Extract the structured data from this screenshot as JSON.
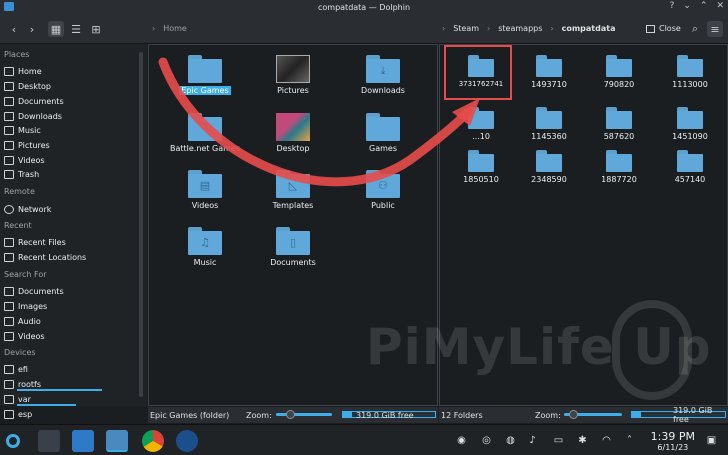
{
  "window": {
    "title": "compatdata — Dolphin"
  },
  "toolbar": {
    "back_icon": "chevron-left",
    "forward_icon": "chevron-right",
    "left_breadcrumb": [
      "Home"
    ],
    "right_breadcrumb": [
      "Steam",
      "steamapps",
      "compatdata"
    ],
    "close_label": "Close"
  },
  "sidebar": {
    "places_header": "Places",
    "places": [
      "Home",
      "Desktop",
      "Documents",
      "Downloads",
      "Music",
      "Pictures",
      "Videos",
      "Trash"
    ],
    "remote_header": "Remote",
    "remote": [
      "Network"
    ],
    "recent_header": "Recent",
    "recent": [
      "Recent Files",
      "Recent Locations"
    ],
    "searchfor_header": "Search For",
    "searchfor": [
      "Documents",
      "Images",
      "Audio",
      "Videos"
    ],
    "devices_header": "Devices",
    "devices": [
      {
        "name": "efi",
        "usage": null
      },
      {
        "name": "rootfs",
        "usage": 0.72
      },
      {
        "name": "var",
        "usage": 0.5
      },
      {
        "name": "esp",
        "usage": null
      }
    ]
  },
  "left_pane": {
    "items": [
      "Epic Games",
      "Pictures",
      "Downloads",
      "Battle.net Games",
      "Desktop",
      "Games",
      "Videos",
      "Templates",
      "Public",
      "Music",
      "Documents"
    ],
    "status": "Epic Games (folder)",
    "zoom_label": "Zoom:",
    "free": "319.0 GiB free"
  },
  "right_pane": {
    "items": [
      "3731762741",
      "1493710",
      "790820",
      "1113000",
      "...10",
      "1145360",
      "587620",
      "1451090",
      "1850510",
      "2348590",
      "1887720",
      "457140"
    ],
    "status": "12 Folders",
    "zoom_label": "Zoom:",
    "free": "319.0 GiB free"
  },
  "taskbar": {
    "time": "1:39 PM",
    "date": "6/11/23"
  },
  "watermark": "PiMyLife Up",
  "colors": {
    "accent": "#3daee9",
    "folder": "#60a8d9",
    "highlight": "#e74c4c"
  }
}
